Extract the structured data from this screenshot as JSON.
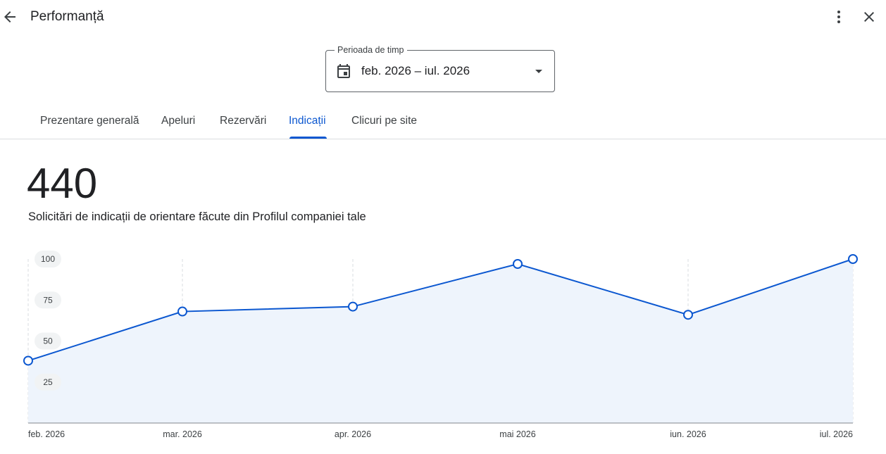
{
  "header": {
    "title": "Performanță",
    "back_icon": "arrow-back-icon",
    "more_icon": "more-vert-icon",
    "close_icon": "close-icon"
  },
  "period": {
    "label": "Perioada de timp",
    "value": "feb. 2026 – iul. 2026",
    "icon": "calendar-icon",
    "dropdown_icon": "arrow-drop-down-icon"
  },
  "tabs": [
    {
      "label": "Prezentare generală",
      "active": false
    },
    {
      "label": "Apeluri",
      "active": false
    },
    {
      "label": "Rezervări",
      "active": false
    },
    {
      "label": "Indicații",
      "active": true
    },
    {
      "label": "Clicuri pe site",
      "active": false
    }
  ],
  "summary": {
    "total": "440",
    "description": "Solicitări de indicații de orientare făcute din Profilul companiei tale"
  },
  "colors": {
    "accent": "#0b57d0",
    "area_fill": "#eef4fc"
  },
  "chart_data": {
    "type": "area",
    "x": [
      "feb. 2026",
      "mar. 2026",
      "apr. 2026",
      "mai 2026",
      "iun. 2026",
      "iul. 2026"
    ],
    "values": [
      38,
      68,
      71,
      97,
      66,
      100
    ],
    "y_ticks": [
      "25",
      "50",
      "75",
      "100"
    ],
    "ylim": [
      0,
      100
    ],
    "grid": "vertical dashed",
    "markers": "hollow circles"
  }
}
